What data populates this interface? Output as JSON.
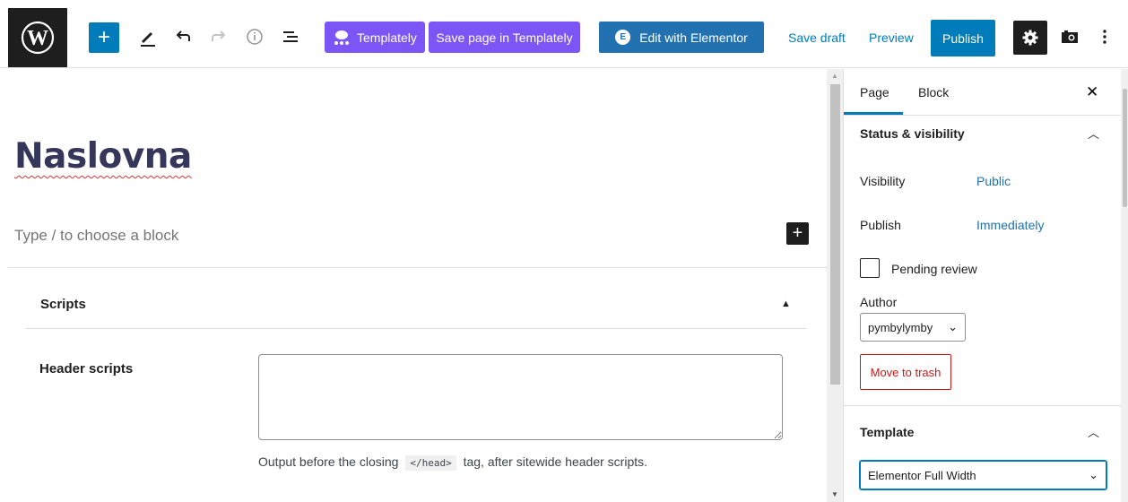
{
  "toolbar": {
    "templately_label": "Templately",
    "save_in_templately_label": "Save page in Templately",
    "elementor_label": "Edit with Elementor",
    "save_draft_label": "Save draft",
    "preview_label": "Preview",
    "publish_label": "Publish",
    "accent_color": "#007cba",
    "templately_color": "#7b55f5"
  },
  "editor": {
    "title": "Naslovna",
    "block_placeholder": "Type / to choose a block"
  },
  "metabox": {
    "title": "Scripts",
    "header_scripts_label": "Header scripts",
    "help_before": "Output before the closing",
    "help_code": "</head>",
    "help_after": "tag, after sitewide header scripts."
  },
  "sidebar": {
    "tabs": [
      {
        "label": "Page"
      },
      {
        "label": "Block"
      }
    ],
    "status_panel": {
      "title": "Status & visibility",
      "visibility_label": "Visibility",
      "visibility_value": "Public",
      "publish_label": "Publish",
      "publish_value": "Immediately",
      "pending_review_label": "Pending review",
      "author_label": "Author",
      "author_value": "pymbylymby",
      "trash_label": "Move to trash"
    },
    "template_panel": {
      "title": "Template",
      "selected": "Elementor Full Width"
    }
  }
}
